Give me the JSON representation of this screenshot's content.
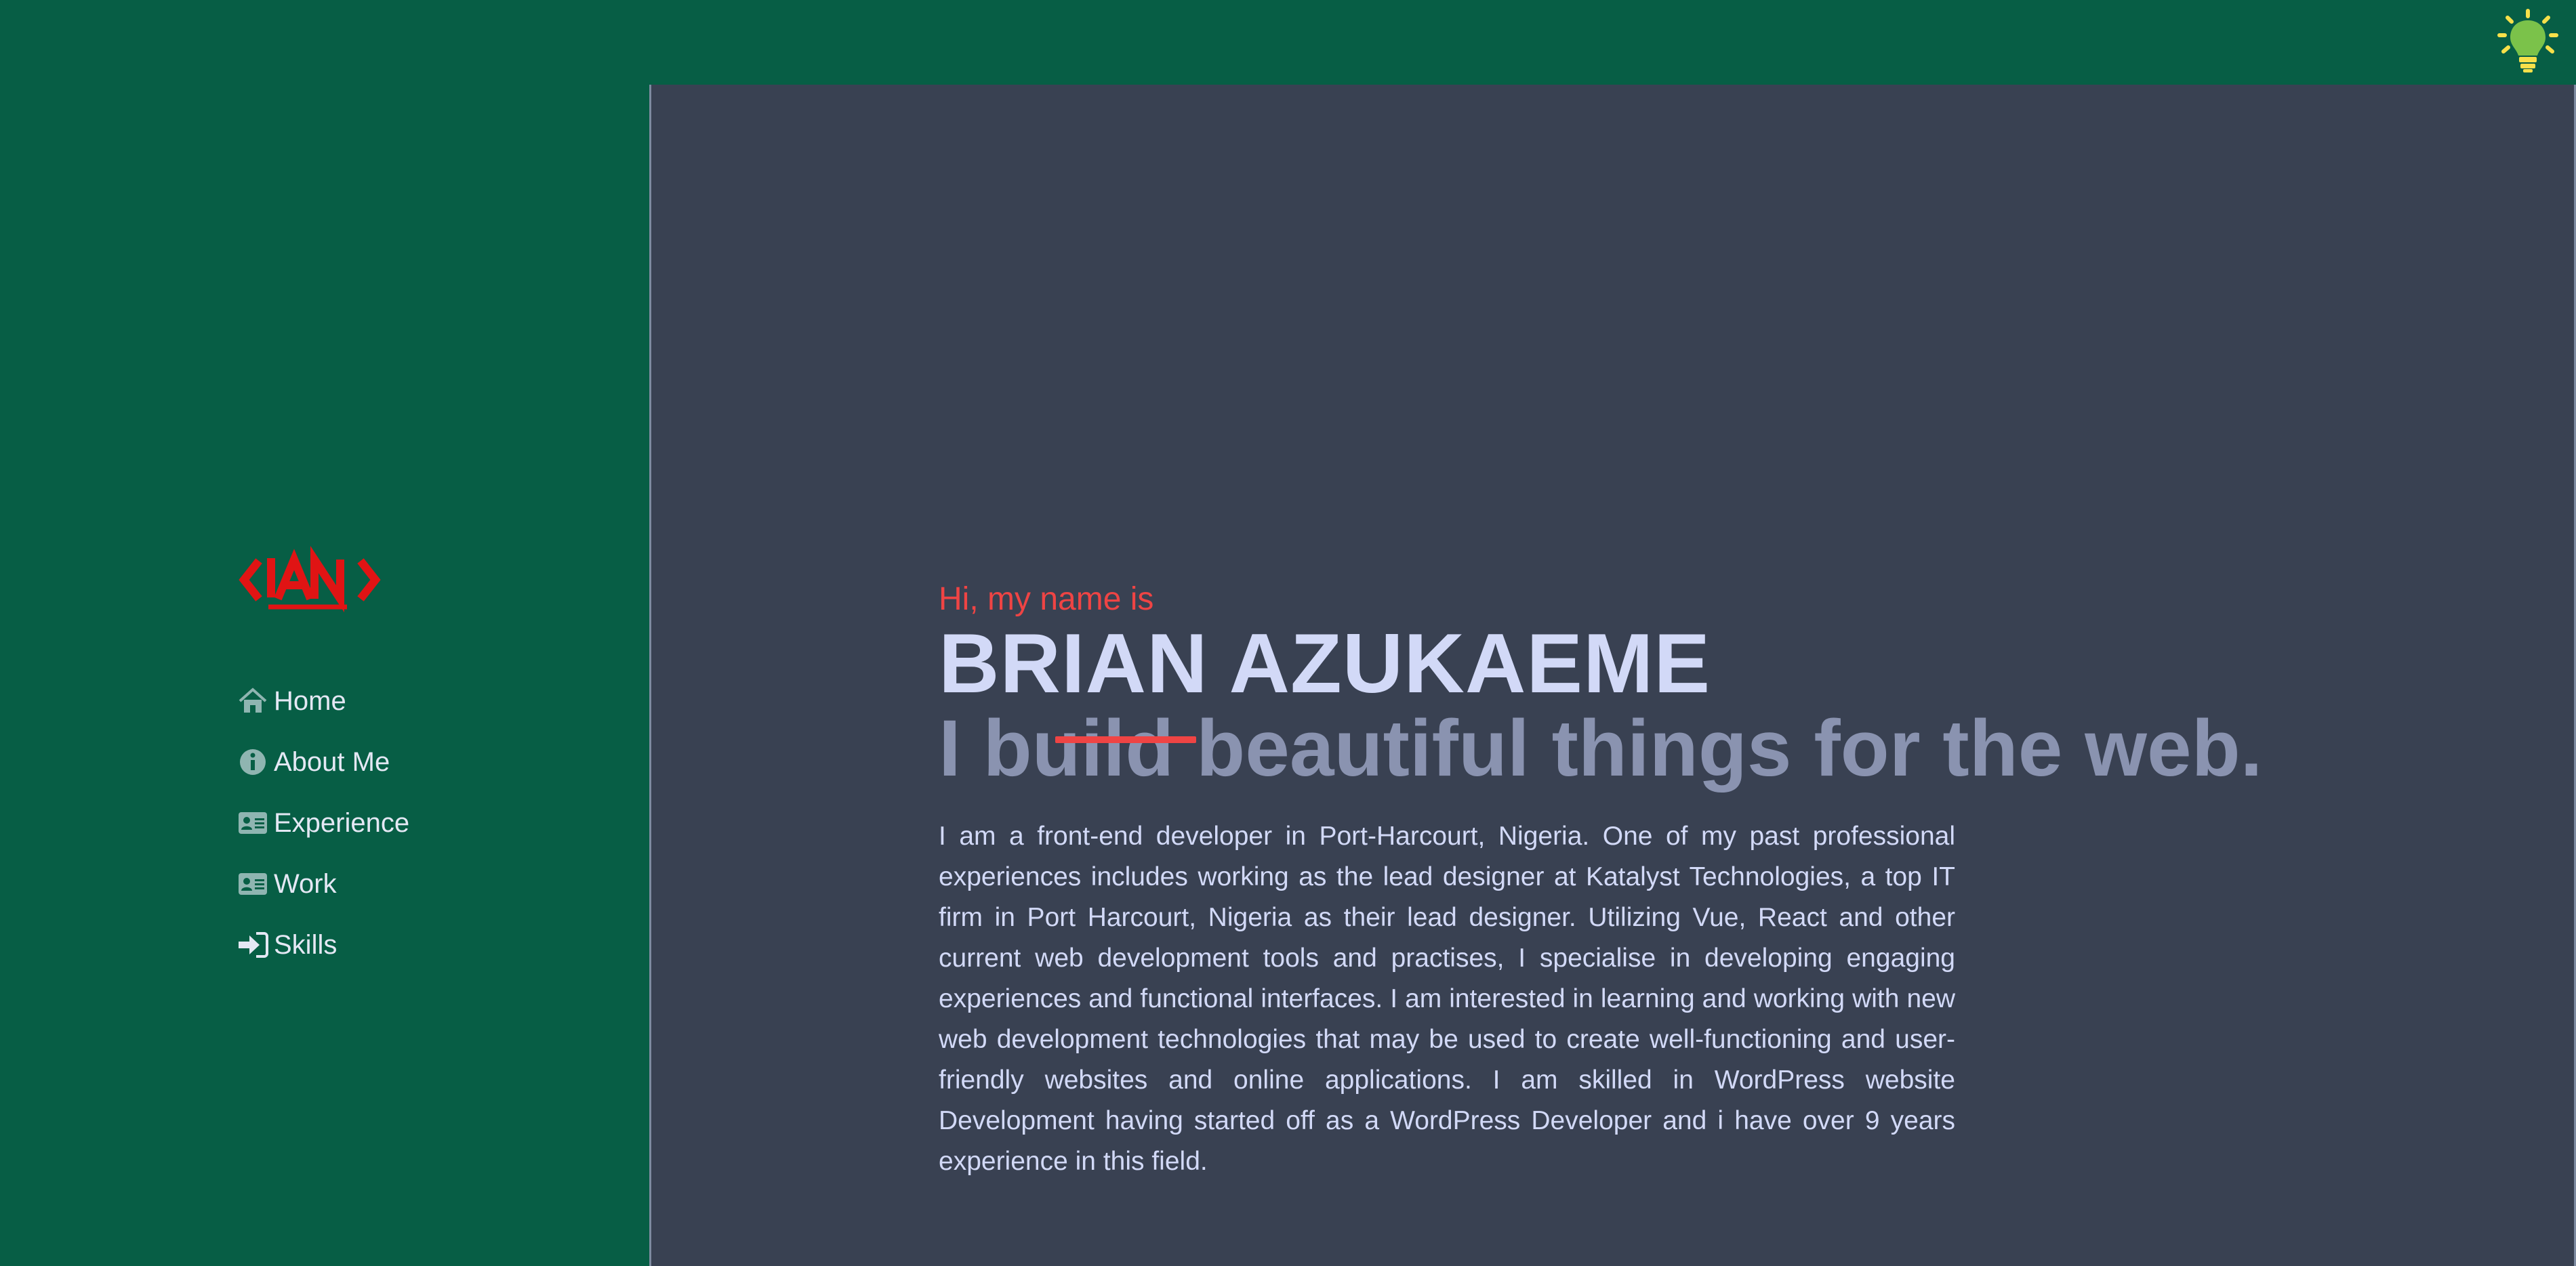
{
  "header": {
    "theme_toggle_icon": "lightbulb-icon",
    "colors": {
      "bulb": "#7bc24a",
      "rays": "#f7e04a"
    }
  },
  "sidebar": {
    "logo_text": "<IAN>",
    "nav": [
      {
        "label": "Home",
        "icon": "home-icon"
      },
      {
        "label": "About Me",
        "icon": "info-icon"
      },
      {
        "label": "Experience",
        "icon": "id-card-icon"
      },
      {
        "label": "Work",
        "icon": "id-card-icon"
      },
      {
        "label": "Skills",
        "icon": "sign-in-icon"
      }
    ]
  },
  "hero": {
    "greeting": "Hi, my name is",
    "name": "BRIAN AZUKAEME",
    "tagline": "I build beautiful things for the web.",
    "bio": "I am a front-end developer in Port-Harcourt, Nigeria. One of my past professional experiences includes working as the lead designer at Katalyst Technologies, a top IT firm in Port Harcourt, Nigeria as their lead designer. Utilizing Vue, React and other current web development tools and practises, I specialise in developing engaging experiences and functional interfaces. I am interested in learning and working with new web development technologies that may be used to create well-functioning and user-friendly websites and online applications. I am skilled in WordPress website Development having started off as a WordPress Developer and i have over 9 years experience in this field."
  },
  "colors": {
    "sidebar_bg": "#075e45",
    "main_bg": "#394152",
    "accent": "#ef4444",
    "name_text": "#d2d9f7",
    "tagline_text": "#8a93b0"
  }
}
